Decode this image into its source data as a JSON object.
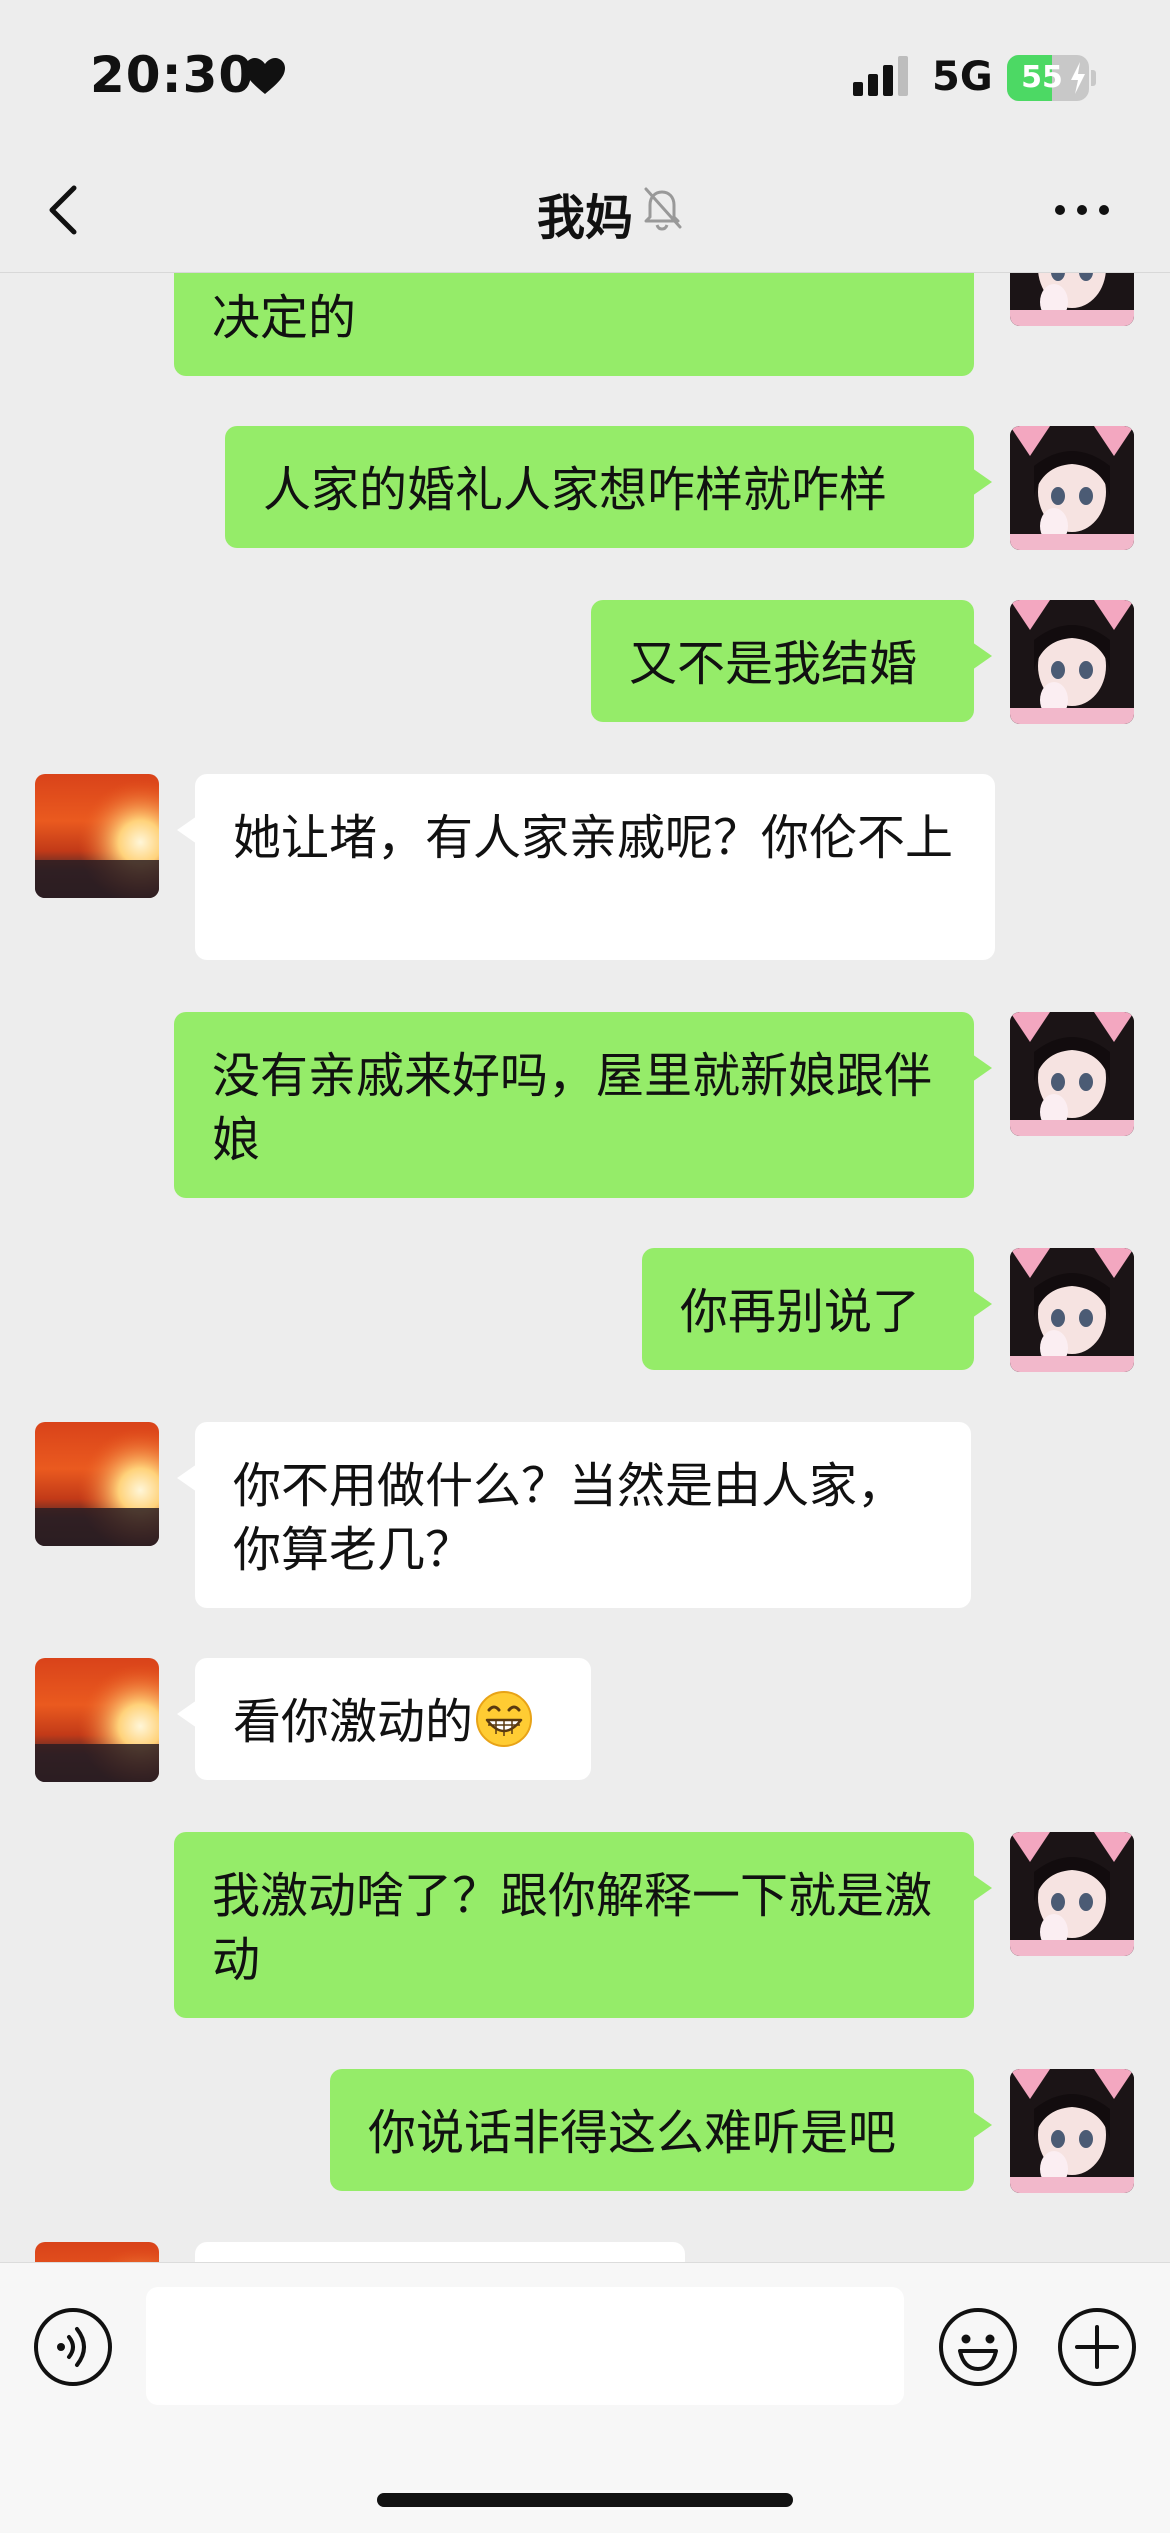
{
  "status_bar": {
    "time": "20:30",
    "network": "5G",
    "battery_percent": 55,
    "battery_label": "55",
    "charging": true,
    "heart_icon": "heart-icon",
    "signal_icon": "cellular-signal-icon"
  },
  "nav": {
    "title": "我妈",
    "back_icon": "chevron-left-icon",
    "mute_icon": "bell-muted-icon",
    "more_icon": "more-dots-icon"
  },
  "messages": [
    {
      "sender": "me",
      "text": "决定的"
    },
    {
      "sender": "me",
      "text": "人家的婚礼人家想咋样就咋样"
    },
    {
      "sender": "me",
      "text": "又不是我结婚"
    },
    {
      "sender": "mom",
      "text": "她让堵，有人家亲戚呢？你伦不上"
    },
    {
      "sender": "me",
      "text": "没有亲戚来好吗，屋里就新娘跟伴娘"
    },
    {
      "sender": "me",
      "text": "你再别说了"
    },
    {
      "sender": "mom",
      "text": "你不用做什么？当然是由人家，你算老几？"
    },
    {
      "sender": "mom",
      "text": "看你激动的",
      "emoji": "grinning-face-emoji"
    },
    {
      "sender": "me",
      "text": "我激动啥了？跟你解释一下就是激动"
    },
    {
      "sender": "me",
      "text": "你说话非得这么难听是吧"
    },
    {
      "sender": "mom",
      "text": ""
    }
  ],
  "input_bar": {
    "voice_icon": "voice-input-icon",
    "input_value": "",
    "emoji_icon": "emoji-icon",
    "plus_icon": "plus-icon"
  },
  "colors": {
    "my_bubble": "#95ec69",
    "mom_bubble": "#ffffff",
    "background": "#ededed",
    "battery_green": "#4cd964"
  }
}
